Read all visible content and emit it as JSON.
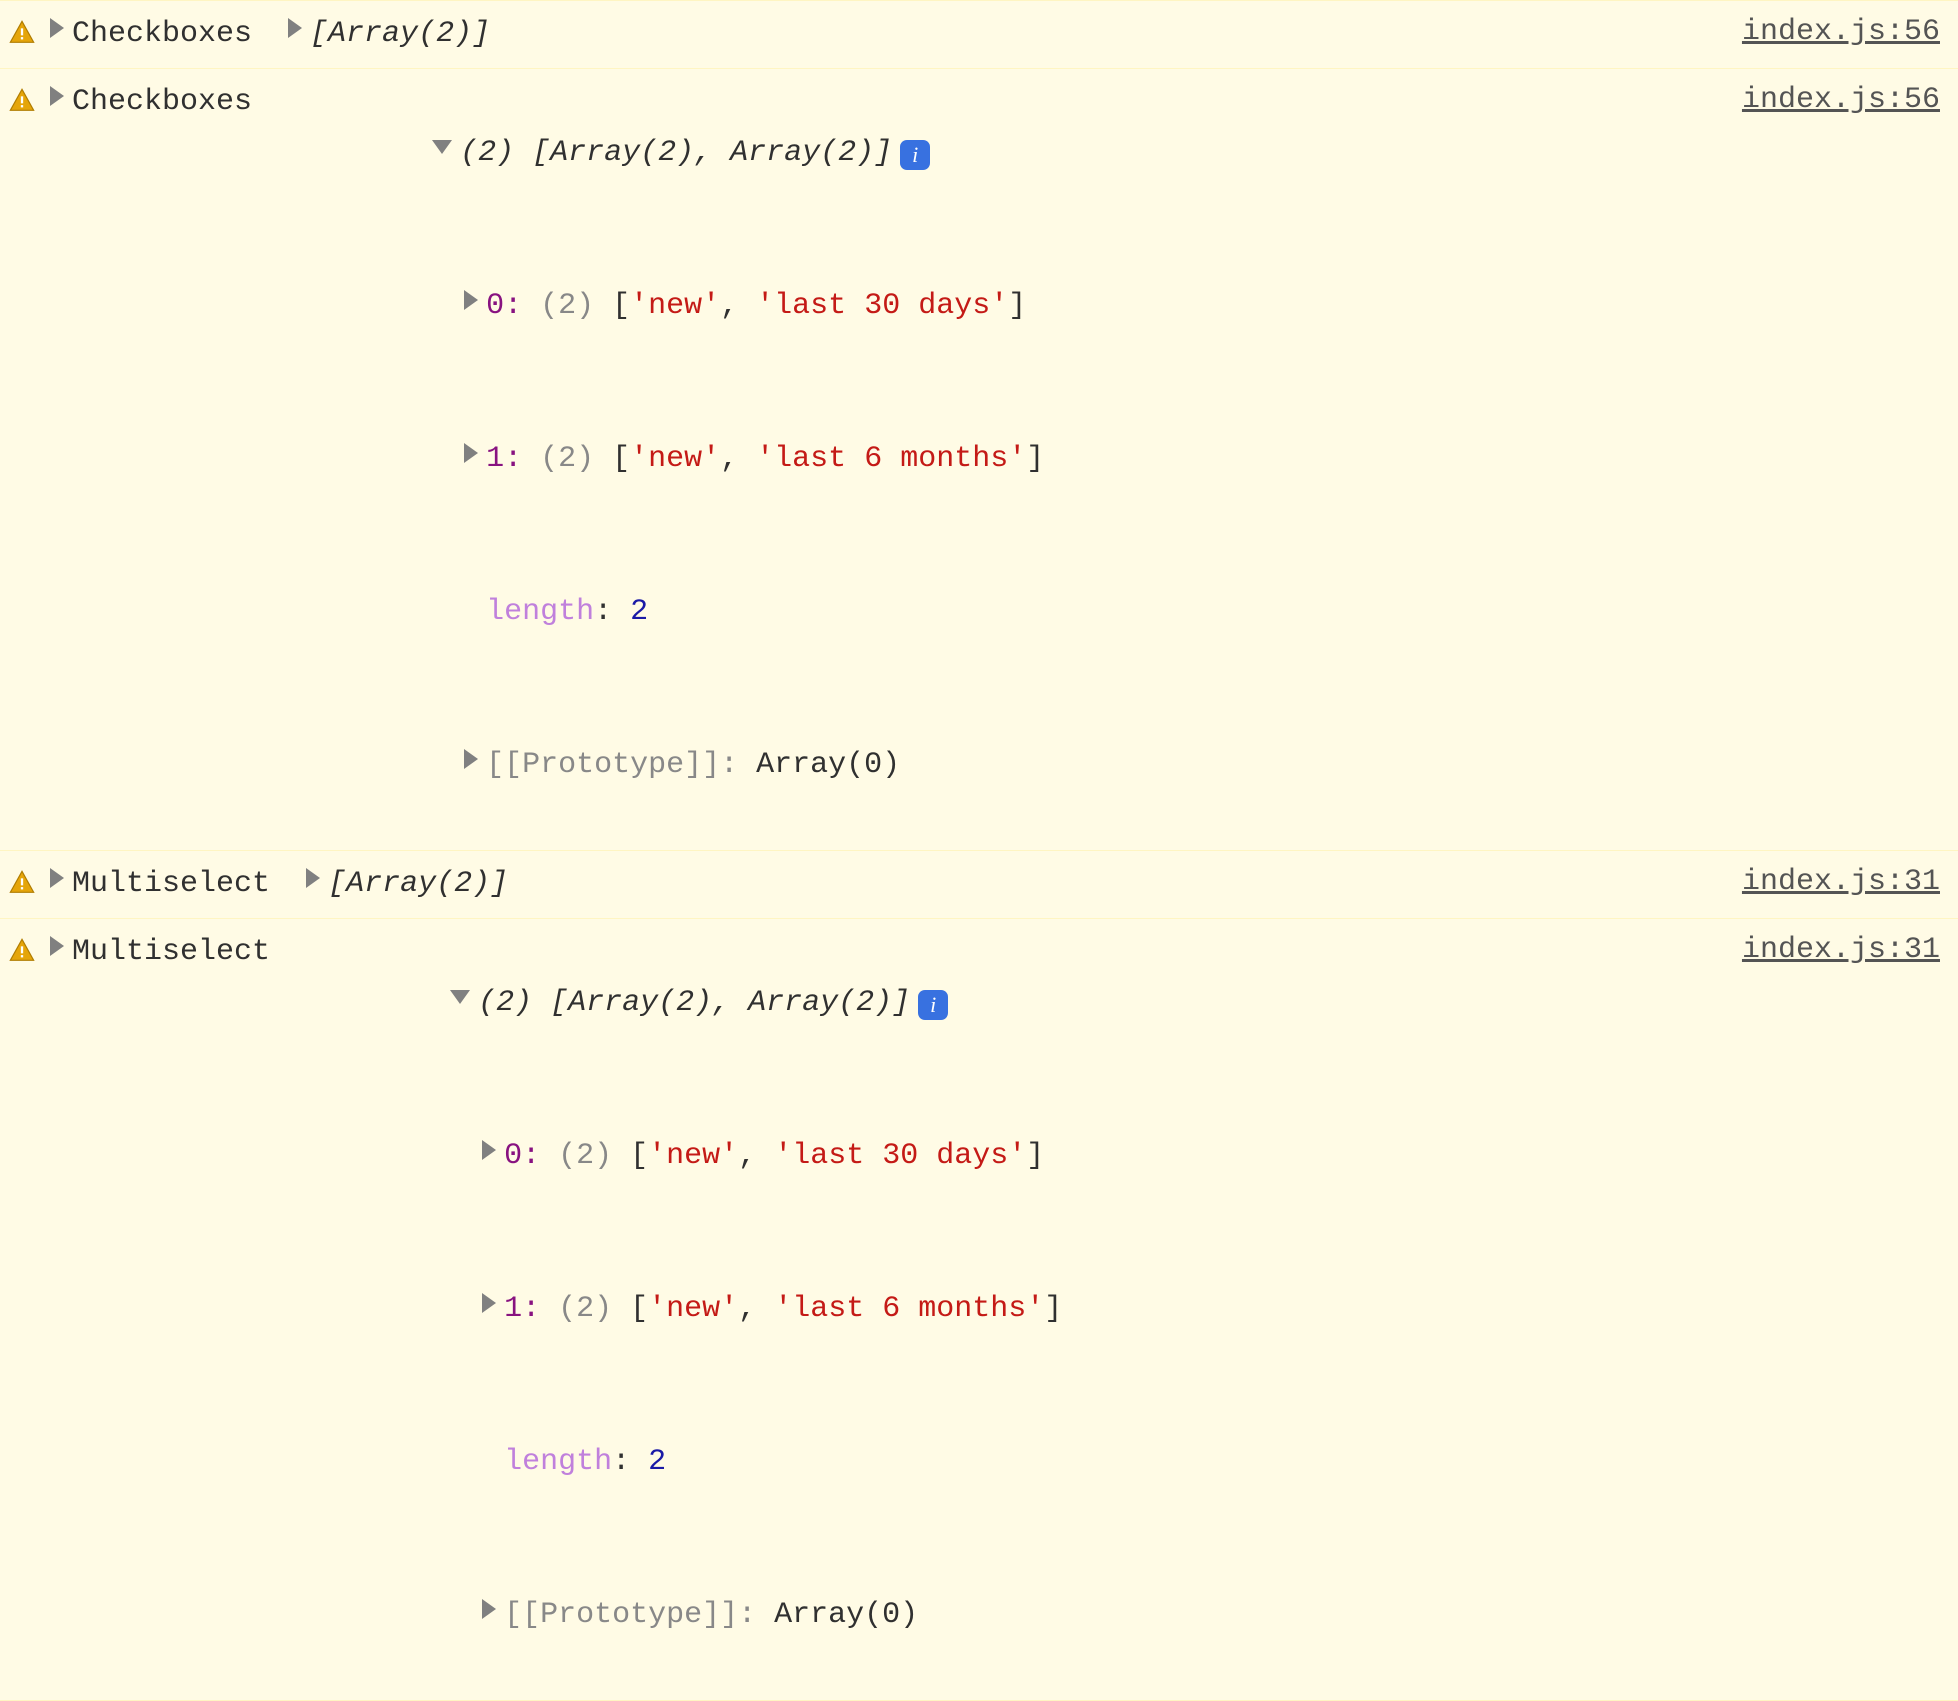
{
  "entries": [
    {
      "label": "Checkboxes",
      "expanded": false,
      "summary": "[Array(2)]",
      "source": "index.js:56"
    },
    {
      "label": "Checkboxes",
      "expanded": true,
      "count": "(2)",
      "summary": "[Array(2), Array(2)]",
      "source": "index.js:56",
      "children": {
        "item0": {
          "key": "0",
          "count": "(2)",
          "vals": [
            "'new'",
            "'last 30 days'"
          ]
        },
        "item1": {
          "key": "1",
          "count": "(2)",
          "vals": [
            "'new'",
            "'last 6 months'"
          ]
        },
        "length_key": "length",
        "length_val": "2",
        "proto_key": "[[Prototype]]",
        "proto_val": "Array(0)"
      }
    },
    {
      "label": "Multiselect",
      "expanded": false,
      "summary": "[Array(2)]",
      "source": "index.js:31"
    },
    {
      "label": "Multiselect",
      "expanded": true,
      "count": "(2)",
      "summary": "[Array(2), Array(2)]",
      "source": "index.js:31",
      "children": {
        "item0": {
          "key": "0",
          "count": "(2)",
          "vals": [
            "'new'",
            "'last 30 days'"
          ]
        },
        "item1": {
          "key": "1",
          "count": "(2)",
          "vals": [
            "'new'",
            "'last 6 months'"
          ]
        },
        "length_key": "length",
        "length_val": "2",
        "proto_key": "[[Prototype]]",
        "proto_val": "Array(0)"
      }
    }
  ],
  "info_glyph": "i"
}
